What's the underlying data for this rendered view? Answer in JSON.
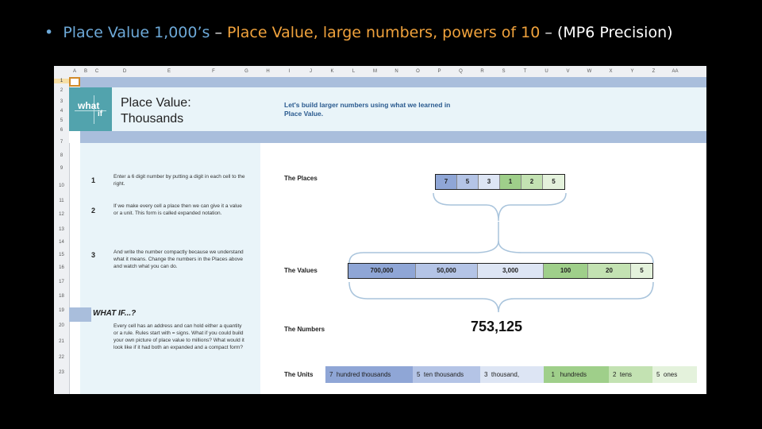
{
  "slide": {
    "bullet": "•",
    "title_part1": "Place Value 1,000’s",
    "dash1": "–",
    "title_part2": "Place Value, large numbers, powers of 10",
    "dash2": "–",
    "title_part3": "(MP6 Precision)"
  },
  "sheet": {
    "columns": [
      "A",
      "B",
      "C",
      "D",
      "E",
      "F",
      "G",
      "H",
      "I",
      "J",
      "K",
      "L",
      "M",
      "N",
      "O",
      "P",
      "Q",
      "R",
      "S",
      "T",
      "U",
      "V",
      "W",
      "X",
      "Y",
      "Z",
      "AA"
    ],
    "rows": [
      "1",
      "2",
      "3",
      "4",
      "5",
      "6",
      "7",
      "8",
      "9",
      "10",
      "11",
      "12",
      "13",
      "14",
      "15",
      "16",
      "17",
      "18",
      "19",
      "20",
      "21",
      "22",
      "23"
    ],
    "logo": {
      "what": "what",
      "if": "if"
    },
    "page_title": "Place Value: Thousands",
    "intro": "Let's build larger numbers using what we learned in Place Value.",
    "steps": [
      {
        "num": "1",
        "text": "Enter a 6 digit number by putting a digit in each cell to the right."
      },
      {
        "num": "2",
        "text": "If we make every cell a place then we can give it a value or a unit. This form is called expanded notation."
      },
      {
        "num": "3",
        "text": "And write the number compactly because we understand what it means. Change the numbers in the Places above and watch what you can do."
      }
    ],
    "whatif_title": "WHAT IF...?",
    "whatif_text": "Every cell has an address and can hold either a quantity or a rule. Rules start with = signs. What if you could build your own picture of place value to millions? What would it look like if it had both an expanded and a compact form?",
    "labels": {
      "places": "The Places",
      "values": "The Values",
      "numbers": "The Numbers",
      "units": "The Units"
    },
    "places": [
      "7",
      "5",
      "3",
      "1",
      "2",
      "5"
    ],
    "values": [
      "700,000",
      "50,000",
      "3,000",
      "100",
      "20",
      "5"
    ],
    "number": "753,125",
    "units": [
      {
        "count": "7",
        "unit": "hundred thousands"
      },
      {
        "count": "5",
        "unit": "ten thousands"
      },
      {
        "count": "3",
        "unit": "thousand,"
      },
      {
        "count": "1",
        "unit": "hundreds"
      },
      {
        "count": "2",
        "unit": "tens"
      },
      {
        "count": "5",
        "unit": "ones"
      }
    ],
    "colors": {
      "hundred_thousands": "#8fa6d6",
      "ten_thousands": "#b4c4e6",
      "thousands": "#dde5f4",
      "hundreds": "#9fcf8a",
      "tens": "#c3e2b2",
      "ones": "#e4f2dc"
    }
  }
}
